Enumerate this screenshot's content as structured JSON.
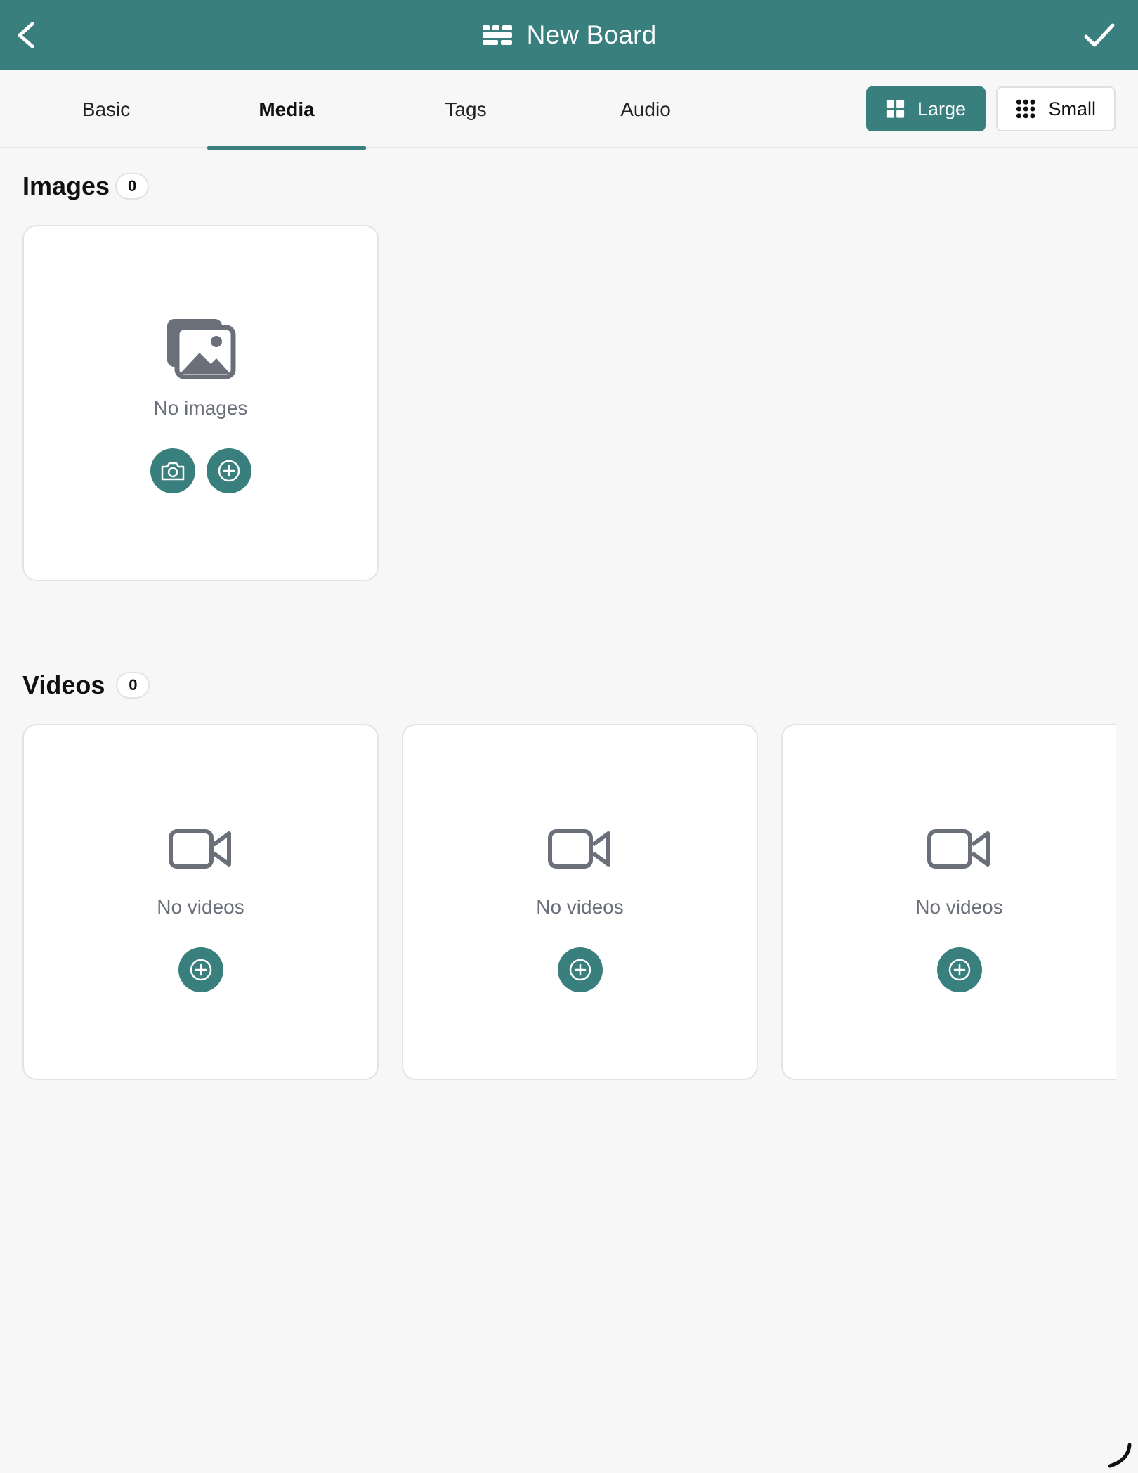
{
  "header": {
    "title": "New Board",
    "back_icon": "chevron-left-icon",
    "done_icon": "checkmark-icon",
    "board_icon": "board-icon"
  },
  "tabs": [
    {
      "label": "Basic",
      "active": false
    },
    {
      "label": "Media",
      "active": true
    },
    {
      "label": "Tags",
      "active": false
    },
    {
      "label": "Audio",
      "active": false
    }
  ],
  "size_toggle": {
    "large_label": "Large",
    "small_label": "Small",
    "selected": "Large"
  },
  "images": {
    "heading": "Images",
    "count": "0",
    "empty_label": "No images"
  },
  "videos": {
    "heading": "Videos",
    "count": "0",
    "cards": [
      {
        "empty_label": "No videos"
      },
      {
        "empty_label": "No videos"
      },
      {
        "empty_label": "No videos"
      }
    ]
  },
  "colors": {
    "accent": "#387f7d",
    "background": "#f7f7f7",
    "muted_text": "#6b6f7a"
  }
}
